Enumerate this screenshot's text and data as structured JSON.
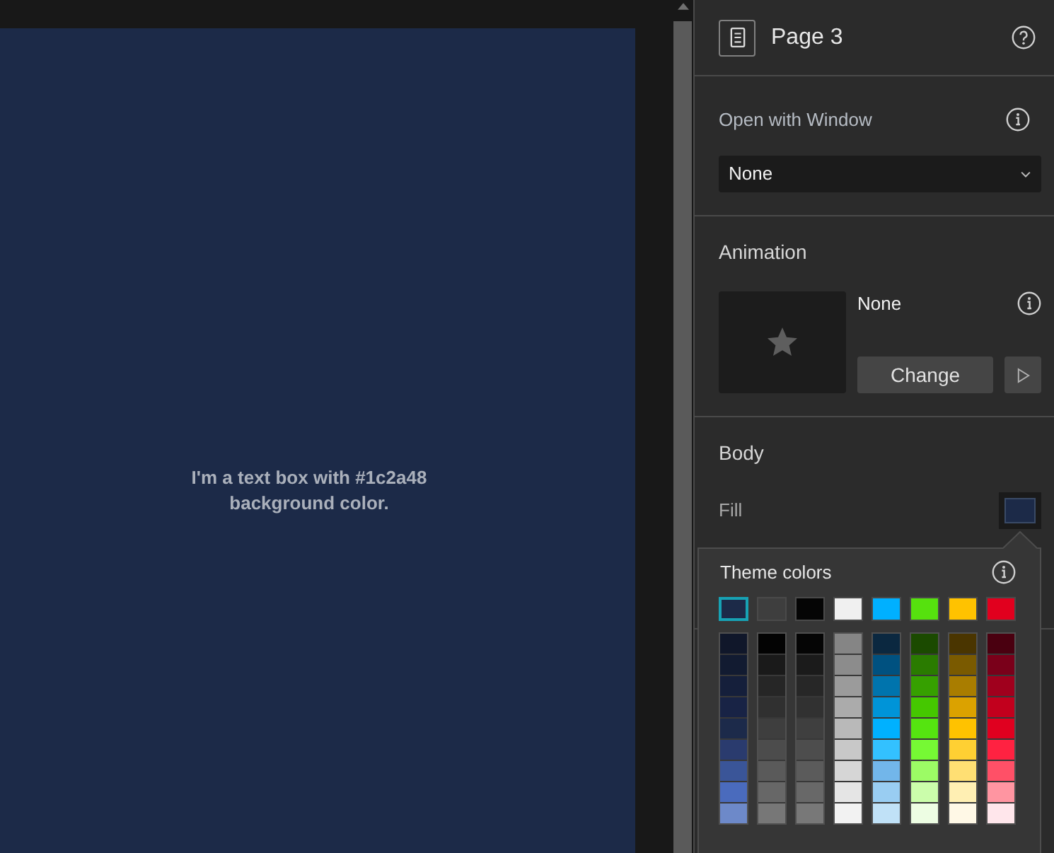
{
  "canvas": {
    "text_box": {
      "text": "I'm a text box with #1c2a48 background color."
    }
  },
  "panel": {
    "title": "Page 3",
    "open_with_window": {
      "label": "Open with Window",
      "dropdown": {
        "value": "None"
      }
    },
    "animation": {
      "title": "Animation",
      "name": "None",
      "button": "Change"
    },
    "body": {
      "title": "Body",
      "fill_label": "Fill"
    }
  },
  "color_popover": {
    "title": "Theme colors",
    "theme_colors": [
      {
        "color": "#1c2a48",
        "selected": true
      },
      {
        "color": "#3e3e3e",
        "selected": false
      },
      {
        "color": "#050505",
        "selected": false
      },
      {
        "color": "#f0f0f0",
        "selected": false
      },
      {
        "color": "#00b0ff",
        "selected": false
      },
      {
        "color": "#56e10e",
        "selected": false
      },
      {
        "color": "#ffc200",
        "selected": false
      },
      {
        "color": "#e1001e",
        "selected": false
      }
    ],
    "shade_columns": [
      {
        "shades": [
          {
            "color": "#10172a"
          },
          {
            "color": "#121b31"
          },
          {
            "color": "#151f3b"
          },
          {
            "color": "#182345"
          },
          {
            "color": "#1c2a4a"
          },
          {
            "color": "#2a3b6e"
          },
          {
            "color": "#3a5598"
          },
          {
            "color": "#4a6bbd"
          },
          {
            "color": "#6d89c9"
          }
        ]
      },
      {
        "shades": [
          {
            "color": "#030303"
          },
          {
            "color": "#1a1a1a"
          },
          {
            "color": "#262626"
          },
          {
            "color": "#303030"
          },
          {
            "color": "#3e3e3e"
          },
          {
            "color": "#4c4c4c"
          },
          {
            "color": "#5a5a5a"
          },
          {
            "color": "#676767"
          },
          {
            "color": "#777777"
          }
        ]
      },
      {
        "shades": [
          {
            "color": "#050505"
          },
          {
            "color": "#1b1b1b"
          },
          {
            "color": "#272727"
          },
          {
            "color": "#313131"
          },
          {
            "color": "#3f3f3f"
          },
          {
            "color": "#4d4d4d"
          },
          {
            "color": "#5b5b5b"
          },
          {
            "color": "#686868"
          },
          {
            "color": "#787878"
          }
        ]
      },
      {
        "shades": [
          {
            "color": "#858585"
          },
          {
            "color": "#8c8c8c"
          },
          {
            "color": "#9b9b9b"
          },
          {
            "color": "#ababab"
          },
          {
            "color": "#b9b9b9"
          },
          {
            "color": "#c8c8c8"
          },
          {
            "color": "#d6d6d6"
          },
          {
            "color": "#e5e5e5"
          },
          {
            "color": "#f2f2f2"
          }
        ]
      },
      {
        "shades": [
          {
            "color": "#0b2840"
          },
          {
            "color": "#005180"
          },
          {
            "color": "#0074ad"
          },
          {
            "color": "#0094d8"
          },
          {
            "color": "#00b1ff"
          },
          {
            "color": "#33c1ff"
          },
          {
            "color": "#72b6ea"
          },
          {
            "color": "#99cdf2"
          },
          {
            "color": "#c0e1f7"
          }
        ]
      },
      {
        "shades": [
          {
            "color": "#1b4a00"
          },
          {
            "color": "#2a7b00"
          },
          {
            "color": "#36a000"
          },
          {
            "color": "#45c800"
          },
          {
            "color": "#55e410"
          },
          {
            "color": "#76f934"
          },
          {
            "color": "#9cfb65"
          },
          {
            "color": "#cbfdab"
          },
          {
            "color": "#edfde3"
          }
        ]
      },
      {
        "shades": [
          {
            "color": "#4a3500"
          },
          {
            "color": "#7a5a00"
          },
          {
            "color": "#a97d00"
          },
          {
            "color": "#dba200"
          },
          {
            "color": "#ffc200"
          },
          {
            "color": "#ffd033"
          },
          {
            "color": "#ffdf73"
          },
          {
            "color": "#ffefb3"
          },
          {
            "color": "#fff8e6"
          }
        ]
      },
      {
        "shades": [
          {
            "color": "#4a0010"
          },
          {
            "color": "#7a001a"
          },
          {
            "color": "#a0001d"
          },
          {
            "color": "#c2001d"
          },
          {
            "color": "#e0001f"
          },
          {
            "color": "#ff2241"
          },
          {
            "color": "#ff5067"
          },
          {
            "color": "#ff95a1"
          },
          {
            "color": "#ffe6eb"
          }
        ]
      }
    ]
  }
}
